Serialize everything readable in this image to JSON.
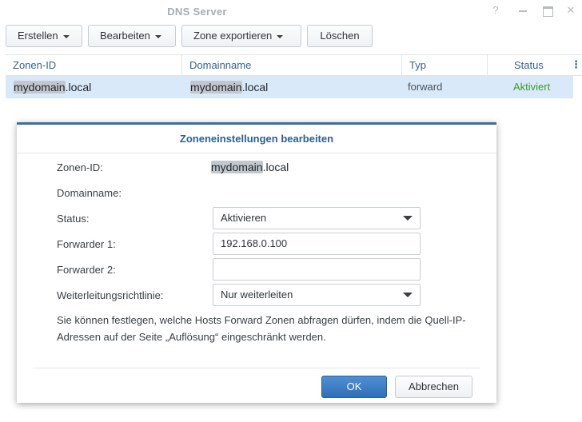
{
  "window": {
    "title": "DNS Server",
    "help_glyph": "?",
    "close_glyph": "✕"
  },
  "toolbar": {
    "create_label": "Erstellen",
    "edit_label": "Bearbeiten",
    "export_zone_label": "Zone exportieren",
    "delete_label": "Löschen"
  },
  "grid": {
    "columns": [
      "Zonen-ID",
      "Domainname",
      "Typ",
      "Status"
    ],
    "more_glyph": "⋮",
    "rows": [
      {
        "zone_id_hidden": "mydomain",
        "zone_id_suffix": ".local",
        "domain_hidden": "mydomain",
        "domain_suffix": ".local",
        "type": "forward",
        "status": "Aktiviert"
      }
    ]
  },
  "dialog": {
    "title": "Zoneneinstellungen bearbeiten",
    "zone_id_label": "Zonen-ID:",
    "zone_id_hidden": "mydomain",
    "zone_id_suffix": ".local",
    "domain_label": "Domainname:",
    "status_label": "Status:",
    "status_value": "Aktivieren",
    "forwarder1_label": "Forwarder 1:",
    "forwarder1_value": "192.168.0.100",
    "forwarder2_label": "Forwarder 2:",
    "forwarder2_value": "",
    "policy_label": "Weiterleitungsrichtlinie:",
    "policy_value": "Nur weiterleiten",
    "note": "Sie können festlegen, welche Hosts Forward Zonen abfragen dürfen, indem die Quell-IP-Adressen auf der Seite „Auflösung“ eingeschränkt werden.",
    "ok_label": "OK",
    "cancel_label": "Abbrechen"
  },
  "colors": {
    "accent": "#3e6da3",
    "status_active": "#3a9d23",
    "selected_row": "#d9e9fa"
  }
}
